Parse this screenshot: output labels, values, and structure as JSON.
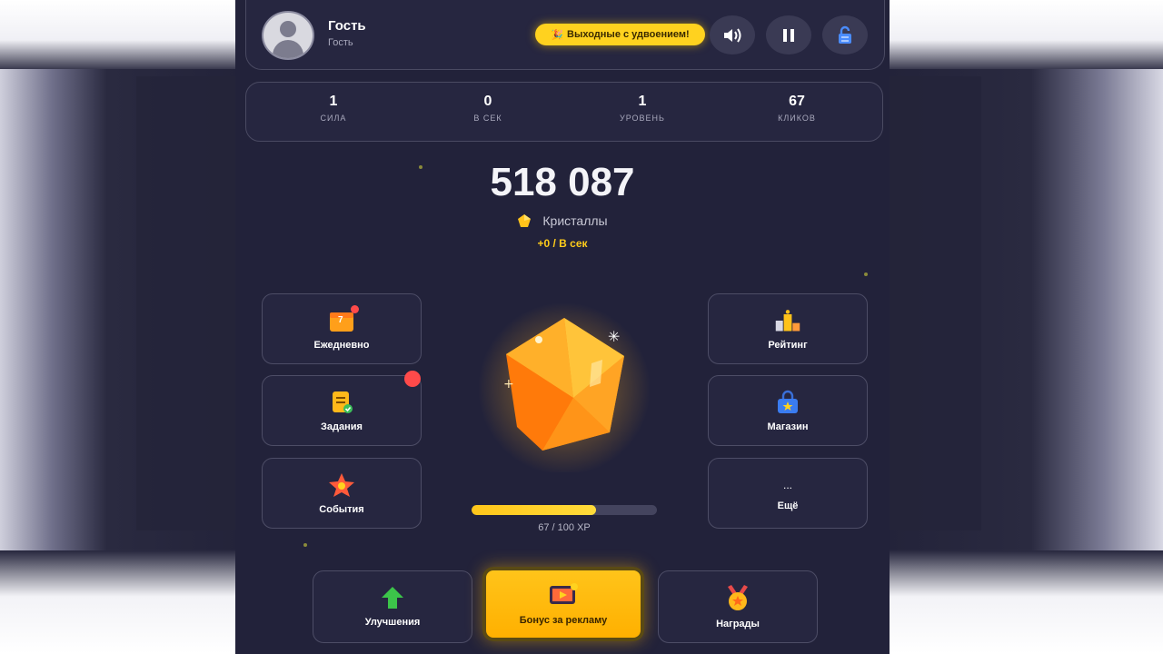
{
  "user": {
    "name": "Гость",
    "subtitle": "Гость"
  },
  "header": {
    "promo_label": "Выходные с удвоением!",
    "icons": [
      "speaker-icon",
      "pause-icon",
      "lock-icon"
    ]
  },
  "stats": [
    {
      "value": "1",
      "label": "СИЛА"
    },
    {
      "value": "0",
      "label": "В СЕК"
    },
    {
      "value": "1",
      "label": "УРОВЕНЬ"
    },
    {
      "value": "67",
      "label": "КЛИКОВ"
    }
  ],
  "score": {
    "value": "518 087",
    "currency": "Кристаллы",
    "rate": "+0 / В сек"
  },
  "left_menu": [
    {
      "label": "Ежедневно",
      "icon": "calendar-icon",
      "icon_text": "7"
    },
    {
      "label": "Задания",
      "icon": "tasks-icon"
    },
    {
      "label": "События",
      "icon": "star-icon"
    }
  ],
  "right_menu": [
    {
      "label": "Рейтинг",
      "icon": "podium-icon"
    },
    {
      "label": "Магазин",
      "icon": "shop-bag-icon"
    },
    {
      "label": "Ещё",
      "icon": "more-icon",
      "icon_text": "..."
    }
  ],
  "xp": {
    "current": 67,
    "max": 100,
    "text": "67 / 100 XP"
  },
  "bottom": [
    {
      "label": "Улучшения",
      "icon": "arrow-up-icon"
    },
    {
      "label": "Бонус за рекламу",
      "icon": "tv-ad-icon"
    },
    {
      "label": "Награды",
      "icon": "medal-icon"
    }
  ],
  "colors": {
    "accent": "#ffc61a",
    "panel": "#262640",
    "bg": "#22223a"
  }
}
